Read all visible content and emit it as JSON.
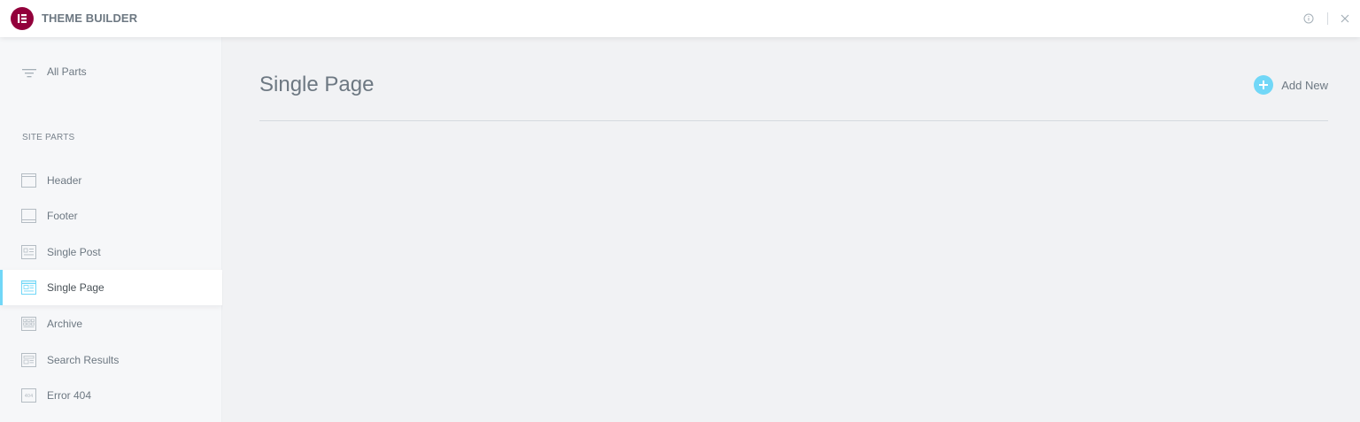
{
  "app": {
    "title": "THEME BUILDER",
    "logo_letter": "E",
    "brand_color": "#92003b",
    "accent_color": "#71d7f7"
  },
  "topbar": {
    "icons": [
      "info-icon",
      "close-icon"
    ]
  },
  "sidebar": {
    "all_parts_label": "All Parts",
    "section_title": "SITE PARTS",
    "items": [
      {
        "label": "Header",
        "icon": "header-icon",
        "active": false
      },
      {
        "label": "Footer",
        "icon": "footer-icon",
        "active": false
      },
      {
        "label": "Single Post",
        "icon": "single-post-icon",
        "active": false
      },
      {
        "label": "Single Page",
        "icon": "single-page-icon",
        "active": true
      },
      {
        "label": "Archive",
        "icon": "archive-icon",
        "active": false
      },
      {
        "label": "Search Results",
        "icon": "search-results-icon",
        "active": false
      },
      {
        "label": "Error 404",
        "icon": "error-404-icon",
        "active": false
      }
    ]
  },
  "main": {
    "page_title": "Single Page",
    "add_new_label": "Add New"
  }
}
